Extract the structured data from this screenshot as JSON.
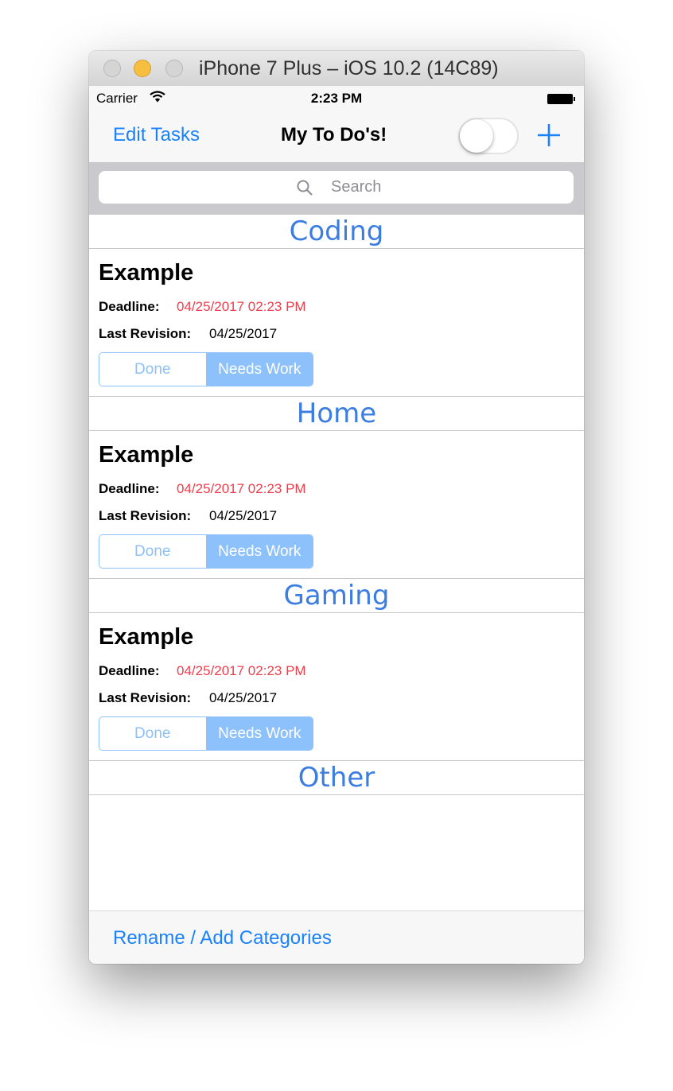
{
  "window": {
    "title": "iPhone 7 Plus – iOS 10.2 (14C89)"
  },
  "status": {
    "carrier": "Carrier",
    "time": "2:23 PM"
  },
  "nav": {
    "edit_label": "Edit Tasks",
    "title": "My To Do's!",
    "toggle_on": false
  },
  "search": {
    "placeholder": "Search"
  },
  "sections": [
    {
      "name": "Coding",
      "task": {
        "title": "Example",
        "deadline_label": "Deadline:",
        "deadline": "04/25/2017 02:23 PM",
        "revision_label": "Last Revision:",
        "revision": "04/25/2017",
        "segments": [
          "Done",
          "Needs Work"
        ],
        "selected": "Needs Work"
      }
    },
    {
      "name": "Home",
      "task": {
        "title": "Example",
        "deadline_label": "Deadline:",
        "deadline": "04/25/2017 02:23 PM",
        "revision_label": "Last Revision:",
        "revision": "04/25/2017",
        "segments": [
          "Done",
          "Needs Work"
        ],
        "selected": "Needs Work"
      }
    },
    {
      "name": "Gaming",
      "task": {
        "title": "Example",
        "deadline_label": "Deadline:",
        "deadline": "04/25/2017 02:23 PM",
        "revision_label": "Last Revision:",
        "revision": "04/25/2017",
        "segments": [
          "Done",
          "Needs Work"
        ],
        "selected": "Needs Work"
      }
    },
    {
      "name": "Other"
    }
  ],
  "toolbar": {
    "categories_label": "Rename / Add Categories"
  },
  "colors": {
    "tint": "#1a82fb",
    "section_header": "#3b7de0",
    "deadline": "#ef3d4b",
    "segment": "#8dc1fb"
  },
  "icons": {
    "wifi": "wifi-icon",
    "battery": "battery-icon",
    "add": "plus-icon",
    "search": "search-icon"
  }
}
